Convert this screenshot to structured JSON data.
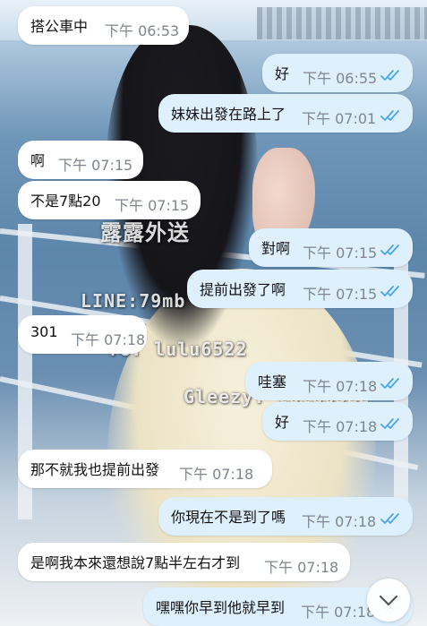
{
  "watermarks": {
    "brand": "露露外送",
    "line": "LINE:79mb",
    "tg": "TG: lulu6522",
    "gleezy": "Gleezy: lulu6522"
  },
  "colors": {
    "incoming_bubble": "#ffffff",
    "outgoing_bubble": "#dff0fd",
    "time_text": "#7f868d",
    "read_tick": "#4aa6e8"
  },
  "messages": [
    {
      "direction": "in",
      "text": "搭公車中",
      "time": "下午 06:53"
    },
    {
      "direction": "out",
      "text": "好",
      "time": "下午 06:55",
      "status": "read"
    },
    {
      "direction": "out",
      "text": "妹妹出發在路上了",
      "time": "下午 07:01",
      "status": "read"
    },
    {
      "direction": "in",
      "text": "啊",
      "time": "下午 07:15"
    },
    {
      "direction": "in",
      "text": "不是7點20",
      "time": "下午 07:15"
    },
    {
      "direction": "out",
      "text": "對啊",
      "time": "下午 07:15",
      "status": "read"
    },
    {
      "direction": "out",
      "text": "提前出發了啊",
      "time": "下午 07:15",
      "status": "read"
    },
    {
      "direction": "in",
      "text": "301",
      "time": "下午 07:18"
    },
    {
      "direction": "out",
      "text": "哇塞",
      "time": "下午 07:18",
      "status": "read"
    },
    {
      "direction": "out",
      "text": "好",
      "time": "下午 07:18",
      "status": "read"
    },
    {
      "direction": "in",
      "text": "那不就我也提前出發",
      "time": "下午 07:18"
    },
    {
      "direction": "out",
      "text": "你現在不是到了嗎",
      "time": "下午 07:18",
      "status": "read"
    },
    {
      "direction": "in",
      "text": "是啊我本來還想說7點半左右才到",
      "time": "下午 07:18"
    },
    {
      "direction": "out",
      "text": "嘿嘿你早到他就早到",
      "time": "下午 07:18",
      "status": "read"
    }
  ],
  "scroll_button": {
    "icon": "chevron-down-icon"
  }
}
